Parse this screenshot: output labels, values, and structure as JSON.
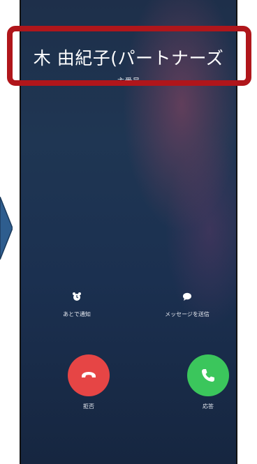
{
  "call": {
    "caller_name": "木 由紀子(パートナーズ",
    "caller_sub": "主番号"
  },
  "quick_actions": {
    "remind_label": "あとで通知",
    "message_label": "メッセージを送信"
  },
  "buttons": {
    "decline_label": "拒否",
    "accept_label": "応答"
  },
  "colors": {
    "highlight": "#b0161b",
    "decline": "#e64545",
    "accept": "#3bc65c",
    "arrow": "#2e5d8e"
  },
  "icons": {
    "remind": "alarm-clock-icon",
    "message": "speech-bubble-icon",
    "decline": "phone-hangup-icon",
    "accept": "phone-icon"
  }
}
